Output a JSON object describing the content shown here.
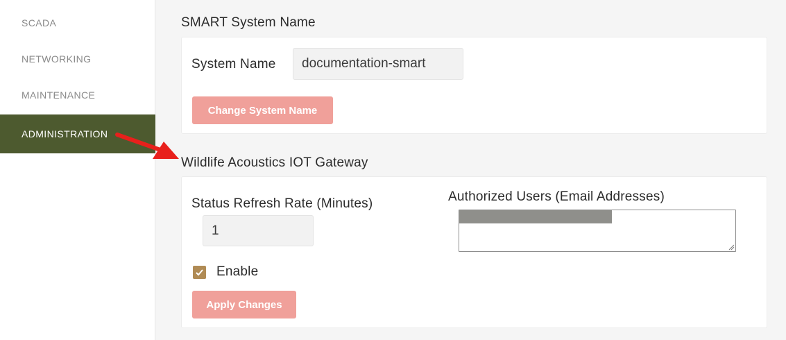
{
  "sidebar": {
    "items": [
      {
        "label": "SCADA"
      },
      {
        "label": "NETWORKING"
      },
      {
        "label": "MAINTENANCE"
      },
      {
        "label": "ADMINISTRATION"
      }
    ]
  },
  "smart": {
    "title": "SMART System Name",
    "system_name_label": "System Name",
    "system_name_value": "documentation-smart",
    "change_button": "Change System Name"
  },
  "gateway": {
    "title": "Wildlife Acoustics IOT Gateway",
    "refresh_label": "Status Refresh Rate (Minutes)",
    "refresh_value": "1",
    "users_label": "Authorized Users (Email Addresses)",
    "enable_label": "Enable",
    "enable_checked": true,
    "apply_button": "Apply Changes"
  },
  "colors": {
    "active_nav": "#4d5a2f",
    "button": "#f0a09a",
    "checkbox": "#b08b55",
    "arrow": "#e8201c"
  }
}
